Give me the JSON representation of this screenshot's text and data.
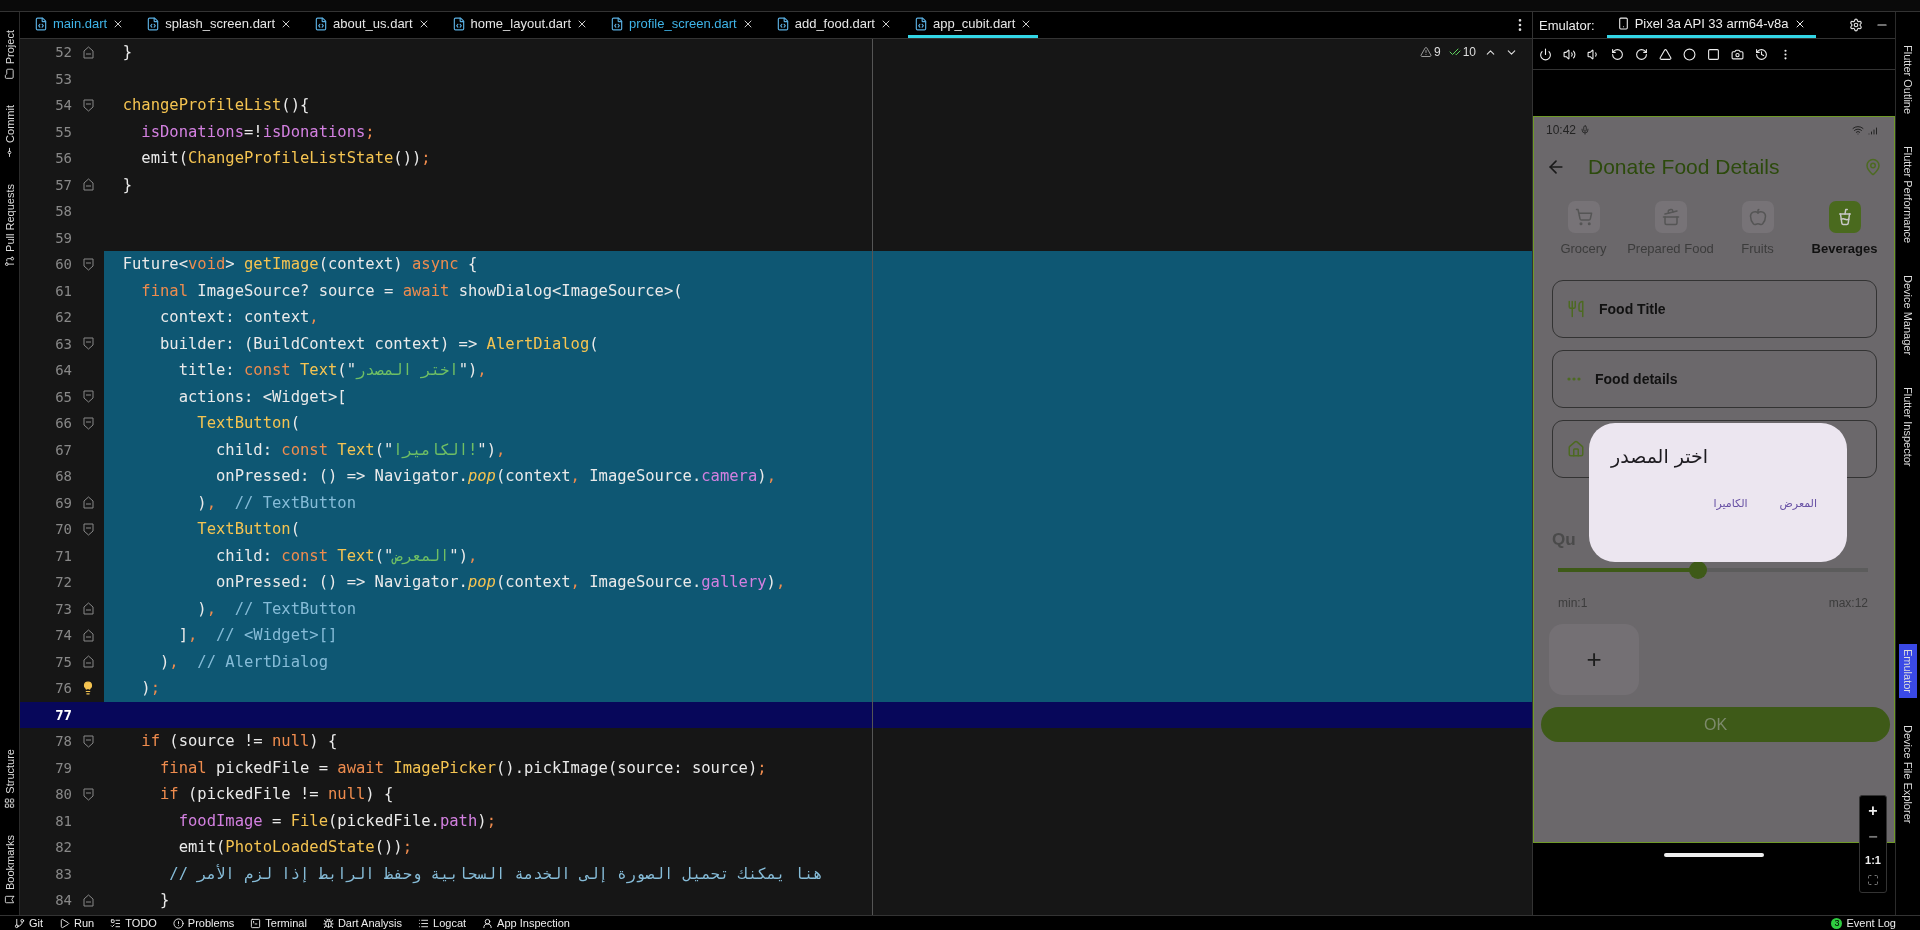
{
  "editor_tabs": [
    {
      "label": "main.dart",
      "modified": true,
      "selected": false
    },
    {
      "label": "splash_screen.dart",
      "modified": false,
      "selected": false
    },
    {
      "label": "about_us.dart",
      "modified": false,
      "selected": false
    },
    {
      "label": "home_layout.dart",
      "modified": false,
      "selected": false
    },
    {
      "label": "profile_screen.dart",
      "modified": true,
      "selected": false
    },
    {
      "label": "add_food.dart",
      "modified": false,
      "selected": false
    },
    {
      "label": "app_cubit.dart",
      "modified": false,
      "selected": true
    }
  ],
  "inspections": {
    "warnings": "9",
    "checks": "10"
  },
  "code_lines": [
    {
      "number": "52",
      "fold_start": false,
      "selected": false,
      "current": false,
      "hint": false,
      "tokens": [
        {
          "kind": "plain",
          "text": "  }"
        }
      ]
    },
    {
      "number": "53",
      "selected": false,
      "current": false,
      "hint": false
    },
    {
      "number": "54",
      "fold_start": true,
      "selected": false,
      "current": false,
      "hint": false,
      "tokens": [
        {
          "kind": "func",
          "text": "  changeProfileList"
        },
        {
          "kind": "plain",
          "text": "(){"
        }
      ]
    },
    {
      "number": "55",
      "selected": false,
      "current": false,
      "hint": false,
      "tokens": [
        {
          "kind": "field",
          "text": "    isDonations"
        },
        {
          "kind": "plain",
          "text": "=!"
        },
        {
          "kind": "field",
          "text": "isDonations"
        },
        {
          "kind": "punct",
          "text": ";"
        }
      ]
    },
    {
      "number": "56",
      "selected": false,
      "current": false,
      "hint": false,
      "tokens": [
        {
          "kind": "plain",
          "text": "    emit("
        },
        {
          "kind": "func",
          "text": "ChangeProfileListState"
        },
        {
          "kind": "plain",
          "text": "())"
        },
        {
          "kind": "punct",
          "text": ";"
        }
      ]
    },
    {
      "number": "57",
      "fold_start": false,
      "selected": false,
      "current": false,
      "hint": false,
      "tokens": [
        {
          "kind": "plain",
          "text": "  }"
        }
      ]
    },
    {
      "number": "58",
      "selected": false,
      "current": false,
      "hint": false
    },
    {
      "number": "59",
      "selected": false,
      "current": false,
      "hint": false
    },
    {
      "number": "60",
      "fold_start": true,
      "selected": true,
      "current": false,
      "hint": false,
      "tokens": [
        {
          "kind": "plain",
          "text": "  Future<"
        },
        {
          "kind": "keyword",
          "text": "void"
        },
        {
          "kind": "plain",
          "text": "> "
        },
        {
          "kind": "func",
          "text": "getImage"
        },
        {
          "kind": "plain",
          "text": "(context) "
        },
        {
          "kind": "keyword",
          "text": "async"
        },
        {
          "kind": "plain",
          "text": " {"
        }
      ]
    },
    {
      "number": "61",
      "selected": true,
      "current": false,
      "hint": false,
      "tokens": [
        {
          "kind": "keyword",
          "text": "    final"
        },
        {
          "kind": "plain",
          "text": " ImageSource? source = "
        },
        {
          "kind": "keyword",
          "text": "await"
        },
        {
          "kind": "plain",
          "text": " showDialog<ImageSource>("
        }
      ]
    },
    {
      "number": "62",
      "selected": true,
      "current": false,
      "hint": false,
      "tokens": [
        {
          "kind": "plain",
          "text": "      context: context"
        },
        {
          "kind": "punct",
          "text": ","
        }
      ]
    },
    {
      "number": "63",
      "fold_start": true,
      "selected": true,
      "current": false,
      "hint": false,
      "tokens": [
        {
          "kind": "plain",
          "text": "      builder: (BuildContext context) => "
        },
        {
          "kind": "func",
          "text": "AlertDialog"
        },
        {
          "kind": "plain",
          "text": "("
        }
      ]
    },
    {
      "number": "64",
      "selected": true,
      "current": false,
      "hint": false,
      "tokens": [
        {
          "kind": "plain",
          "text": "        title: "
        },
        {
          "kind": "keyword",
          "text": "const "
        },
        {
          "kind": "func",
          "text": "Text"
        },
        {
          "kind": "plain",
          "text": "(\""
        },
        {
          "kind": "string",
          "text": "اختر المصدر"
        },
        {
          "kind": "plain",
          "text": "\")"
        },
        {
          "kind": "punct",
          "text": ","
        }
      ]
    },
    {
      "number": "65",
      "fold_start": true,
      "selected": true,
      "current": false,
      "hint": false,
      "tokens": [
        {
          "kind": "plain",
          "text": "        actions: <Widget>["
        }
      ]
    },
    {
      "number": "66",
      "fold_start": true,
      "selected": true,
      "current": false,
      "hint": false,
      "tokens": [
        {
          "kind": "func",
          "text": "          TextButton"
        },
        {
          "kind": "plain",
          "text": "("
        }
      ]
    },
    {
      "number": "67",
      "selected": true,
      "current": false,
      "hint": false,
      "tokens": [
        {
          "kind": "plain",
          "text": "            child: "
        },
        {
          "kind": "keyword",
          "text": "const "
        },
        {
          "kind": "func",
          "text": "Text"
        },
        {
          "kind": "plain",
          "text": "(\""
        },
        {
          "kind": "string",
          "text": "الكاميرا!"
        },
        {
          "kind": "plain",
          "text": "\")"
        },
        {
          "kind": "punct",
          "text": ","
        }
      ]
    },
    {
      "number": "68",
      "selected": true,
      "current": false,
      "hint": false,
      "tokens": [
        {
          "kind": "plain",
          "text": "            onPressed: () => Navigator."
        },
        {
          "kind": "method",
          "text": "pop"
        },
        {
          "kind": "plain",
          "text": "(context"
        },
        {
          "kind": "punct",
          "text": ","
        },
        {
          "kind": "plain",
          "text": " ImageSource."
        },
        {
          "kind": "field",
          "text": "camera"
        },
        {
          "kind": "plain",
          "text": ")"
        },
        {
          "kind": "punct",
          "text": ","
        }
      ]
    },
    {
      "number": "69",
      "fold_start": false,
      "selected": true,
      "current": false,
      "hint": false,
      "tokens": [
        {
          "kind": "plain",
          "text": "          )"
        },
        {
          "kind": "punct",
          "text": ","
        },
        {
          "kind": "comment",
          "text": "  // TextButton"
        }
      ]
    },
    {
      "number": "70",
      "fold_start": true,
      "selected": true,
      "current": false,
      "hint": false,
      "tokens": [
        {
          "kind": "func",
          "text": "          TextButton"
        },
        {
          "kind": "plain",
          "text": "("
        }
      ]
    },
    {
      "number": "71",
      "selected": true,
      "current": false,
      "hint": false,
      "tokens": [
        {
          "kind": "plain",
          "text": "            child: "
        },
        {
          "kind": "keyword",
          "text": "const "
        },
        {
          "kind": "func",
          "text": "Text"
        },
        {
          "kind": "plain",
          "text": "(\""
        },
        {
          "kind": "string",
          "text": "المعرض"
        },
        {
          "kind": "plain",
          "text": "\")"
        },
        {
          "kind": "punct",
          "text": ","
        }
      ]
    },
    {
      "number": "72",
      "selected": true,
      "current": false,
      "hint": false,
      "tokens": [
        {
          "kind": "plain",
          "text": "            onPressed: () => Navigator."
        },
        {
          "kind": "method",
          "text": "pop"
        },
        {
          "kind": "plain",
          "text": "(context"
        },
        {
          "kind": "punct",
          "text": ","
        },
        {
          "kind": "plain",
          "text": " ImageSource."
        },
        {
          "kind": "field",
          "text": "gallery"
        },
        {
          "kind": "plain",
          "text": ")"
        },
        {
          "kind": "punct",
          "text": ","
        }
      ]
    },
    {
      "number": "73",
      "fold_start": false,
      "selected": true,
      "current": false,
      "hint": false,
      "tokens": [
        {
          "kind": "plain",
          "text": "          )"
        },
        {
          "kind": "punct",
          "text": ","
        },
        {
          "kind": "comment",
          "text": "  // TextButton"
        }
      ]
    },
    {
      "number": "74",
      "fold_start": false,
      "selected": true,
      "current": false,
      "hint": false,
      "tokens": [
        {
          "kind": "plain",
          "text": "        ]"
        },
        {
          "kind": "punct",
          "text": ","
        },
        {
          "kind": "comment",
          "text": "  // <Widget>[]"
        }
      ]
    },
    {
      "number": "75",
      "fold_start": false,
      "selected": true,
      "current": false,
      "hint": false,
      "tokens": [
        {
          "kind": "plain",
          "text": "      )"
        },
        {
          "kind": "punct",
          "text": ","
        },
        {
          "kind": "comment",
          "text": "  // AlertDialog"
        }
      ]
    },
    {
      "number": "76",
      "selected": true,
      "current": false,
      "hint": true,
      "tokens": [
        {
          "kind": "plain",
          "text": "    )"
        },
        {
          "kind": "punct",
          "text": ";"
        }
      ]
    },
    {
      "number": "77",
      "selected": false,
      "current": true,
      "hint": false
    },
    {
      "number": "78",
      "fold_start": true,
      "selected": false,
      "current": false,
      "hint": false,
      "tokens": [
        {
          "kind": "keyword",
          "text": "    if"
        },
        {
          "kind": "plain",
          "text": " (source != "
        },
        {
          "kind": "keyword",
          "text": "null"
        },
        {
          "kind": "plain",
          "text": ") {"
        }
      ]
    },
    {
      "number": "79",
      "selected": false,
      "current": false,
      "hint": false,
      "tokens": [
        {
          "kind": "keyword",
          "text": "      final"
        },
        {
          "kind": "plain",
          "text": " pickedFile = "
        },
        {
          "kind": "keyword",
          "text": "await "
        },
        {
          "kind": "func",
          "text": "ImagePicker"
        },
        {
          "kind": "plain",
          "text": "().pickImage(source: source)"
        },
        {
          "kind": "punct",
          "text": ";"
        }
      ]
    },
    {
      "number": "80",
      "fold_start": true,
      "selected": false,
      "current": false,
      "hint": false,
      "tokens": [
        {
          "kind": "keyword",
          "text": "      if"
        },
        {
          "kind": "plain",
          "text": " (pickedFile != "
        },
        {
          "kind": "keyword",
          "text": "null"
        },
        {
          "kind": "plain",
          "text": ") {"
        }
      ]
    },
    {
      "number": "81",
      "selected": false,
      "current": false,
      "hint": false,
      "tokens": [
        {
          "kind": "field",
          "text": "        foodImage"
        },
        {
          "kind": "plain",
          "text": " = "
        },
        {
          "kind": "func",
          "text": "File"
        },
        {
          "kind": "plain",
          "text": "(pickedFile."
        },
        {
          "kind": "field",
          "text": "path"
        },
        {
          "kind": "plain",
          "text": ")"
        },
        {
          "kind": "punct",
          "text": ";"
        }
      ]
    },
    {
      "number": "82",
      "selected": false,
      "current": false,
      "hint": false,
      "tokens": [
        {
          "kind": "plain",
          "text": "        emit("
        },
        {
          "kind": "func",
          "text": "PhotoLoadedState"
        },
        {
          "kind": "plain",
          "text": "())"
        },
        {
          "kind": "punct",
          "text": ";"
        }
      ]
    },
    {
      "number": "83",
      "selected": false,
      "current": false,
      "hint": false,
      "tokens": [
        {
          "kind": "comment",
          "text": "       // هنا يمكنك تحميل الصورة إلى الخدمة السحابية وحفظ الرابط إذا لزم الأمر"
        }
      ]
    },
    {
      "number": "84",
      "fold_start": false,
      "selected": false,
      "current": false,
      "hint": false,
      "tokens": [
        {
          "kind": "plain",
          "text": "      }"
        }
      ]
    }
  ],
  "left_tools_top": [
    "Project",
    "Commit",
    "Pull Requests"
  ],
  "left_tools_bottom": [
    "Structure",
    "Bookmarks"
  ],
  "emulator": {
    "label": "Emulator:",
    "device_tab": {
      "label": "Pixel 3a API 33 arm64-v8a",
      "selected": true
    },
    "phone": {
      "time": "10:42",
      "title": "Donate Food Details",
      "categories": [
        {
          "label": "Grocery",
          "selected": false
        },
        {
          "label": "Prepared Food",
          "selected": false
        },
        {
          "label": "Fruits",
          "selected": false
        },
        {
          "label": "Beverages",
          "selected": true
        }
      ],
      "fields": [
        {
          "kind": "text",
          "label": "Food Title"
        },
        {
          "kind": "text",
          "label": "Food details"
        },
        {
          "kind": "covered"
        }
      ],
      "quantity_label": "Qu",
      "slider": {
        "level": 0.45,
        "min": "min:1",
        "max": "max:12"
      },
      "add_photo": "+",
      "ok_button": "OK",
      "dialog": {
        "title": "اختر المصدر",
        "actions": [
          "المعرض",
          "الكاميرا"
        ]
      }
    },
    "zoom_controls": {
      "plus": "+",
      "minus": "−",
      "reset": "1:1"
    }
  },
  "right_tools": [
    {
      "label": "Flutter Outline",
      "selected": false
    },
    {
      "label": "Flutter Performance",
      "selected": false
    },
    {
      "label": "Device Manager",
      "selected": false
    },
    {
      "label": "Flutter Inspector",
      "selected": false
    },
    {
      "label": "Emulator",
      "selected": true
    },
    {
      "label": "Device File Explorer",
      "selected": false
    }
  ],
  "status_bar": {
    "items": [
      "Git",
      "Run",
      "TODO",
      "Problems",
      "Terminal",
      "Dart Analysis",
      "Logcat",
      "App Inspection"
    ],
    "event_log": {
      "count": "3",
      "label": "Event Log"
    }
  }
}
